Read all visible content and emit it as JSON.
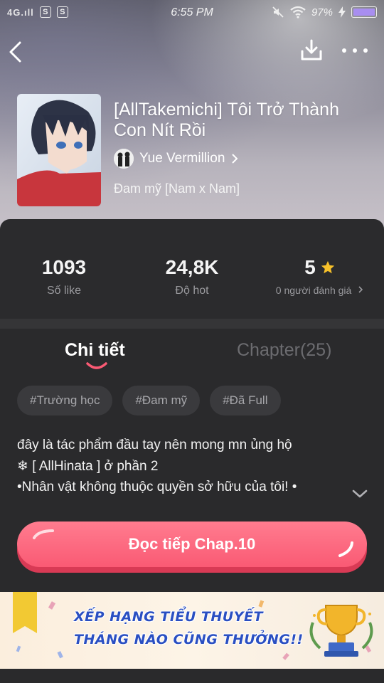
{
  "status_bar": {
    "signal": "4G.ıll",
    "s_icon_1": "S",
    "s_icon_2": "S",
    "time": "6:55 PM",
    "battery": "97%"
  },
  "book": {
    "title": "[AllTakemichi] Tôi Trở Thành Con Nít Rồi",
    "author": "Yue Vermillion",
    "genre": "Đam mỹ [Nam x Nam]"
  },
  "stats": {
    "likes": {
      "value": "1093",
      "label": "Số like"
    },
    "hot": {
      "value": "24,8K",
      "label": "Độ hot"
    },
    "rating": {
      "value": "5",
      "label": "0 người đánh giá"
    }
  },
  "tabs": {
    "details": "Chi tiết",
    "chapters": "Chapter(25)"
  },
  "tags": [
    "#Trường học",
    "#Đam mỹ",
    "#Đã Full"
  ],
  "description": {
    "line1": "đây là tác phẩm đầu tay nên mong mn ủng hộ",
    "line2": "❄ [ AllHinata ] ở phần 2",
    "line3": "•Nhân vật không thuộc quyền sở hữu của tôi! •"
  },
  "read_button": "Đọc tiếp Chap.10",
  "banner": {
    "line1": "XẾP HẠNG TIỂU THUYẾT",
    "line2": "THÁNG NÀO CŨNG THƯỞNG!!"
  },
  "colors": {
    "accent": "#fa5a74",
    "star": "#f7c12a",
    "banner_text": "#2a4fc2",
    "battery": "#a88ef0"
  },
  "icons": [
    "back-icon",
    "download-icon",
    "more-icon",
    "star-icon",
    "chevron-right-icon",
    "chevron-down-icon",
    "trophy-icon"
  ]
}
